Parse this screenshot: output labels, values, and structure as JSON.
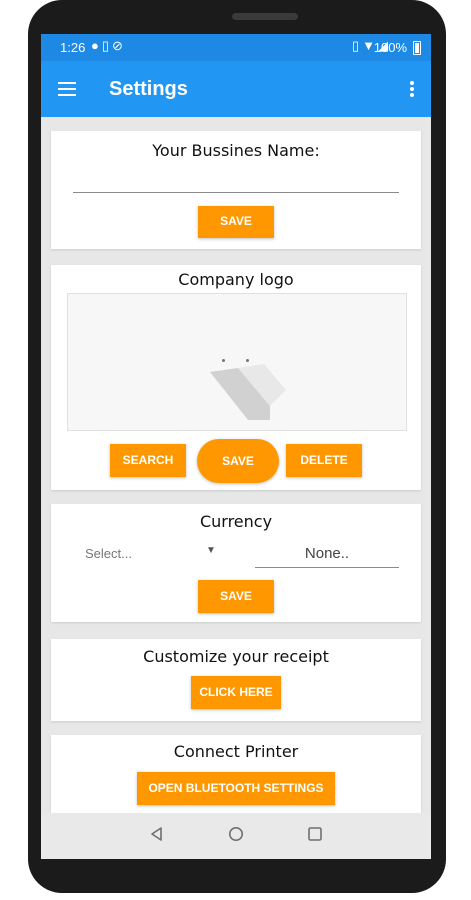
{
  "status_bar": {
    "time": "1:26",
    "left_icons": [
      "message-icon",
      "sim-icon",
      "no-disturb-icon"
    ],
    "right_icons": [
      "vibrate-icon",
      "wifi-icon",
      "signal-icon"
    ],
    "battery": "100%"
  },
  "app_bar": {
    "title": "Settings",
    "menu_icon": "hamburger-menu-icon",
    "overflow_icon": "more-vert-icon"
  },
  "business_name": {
    "label": "Your Bussines Name:",
    "value": "",
    "save_label": "SAVE"
  },
  "company_logo": {
    "label": "Company logo",
    "search_label": "SEARCH",
    "save_label": "SAVE",
    "delete_label": "DELETE"
  },
  "currency": {
    "label": "Currency",
    "select_value": "Select...",
    "field_value": "None..",
    "save_label": "SAVE"
  },
  "receipt": {
    "label": "Customize your receipt",
    "button_label": "CLICK HERE"
  },
  "printer": {
    "label": "Connect Printer",
    "button_label": "OPEN BLUETOOTH SETTINGS"
  },
  "colors": {
    "primary": "#2196f3",
    "status_bar": "#1e88e5",
    "accent": "#ff9800"
  },
  "nav_bar": {
    "back": "back-icon",
    "home": "home-icon",
    "recents": "recents-icon"
  }
}
